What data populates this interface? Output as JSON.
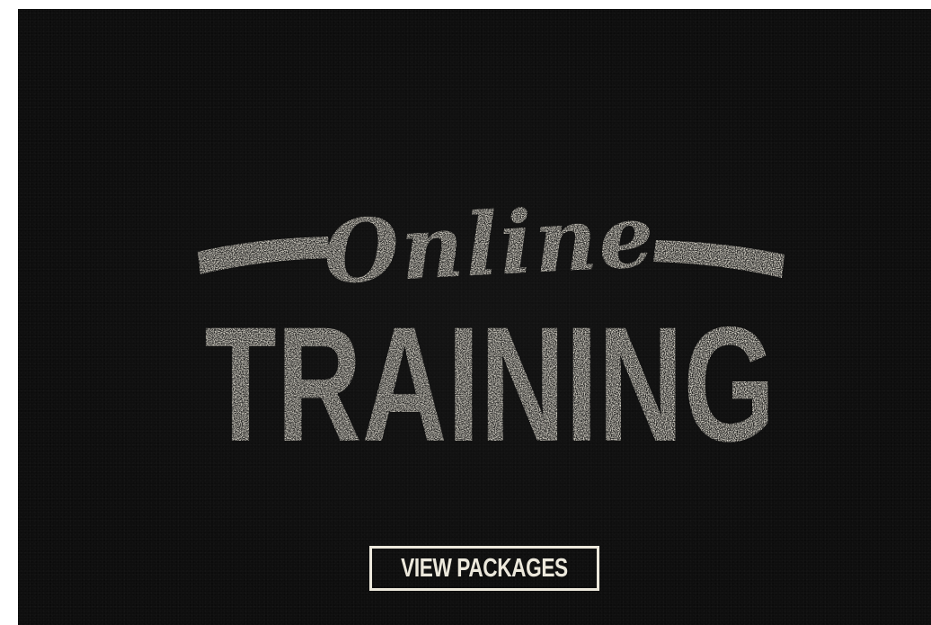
{
  "banner": {
    "script_word": "Online",
    "block_word": "TRAINING",
    "cta_label": "VIEW PACKAGES"
  },
  "colors": {
    "background": "#0d0d0d",
    "ink": "#ece8dc"
  }
}
